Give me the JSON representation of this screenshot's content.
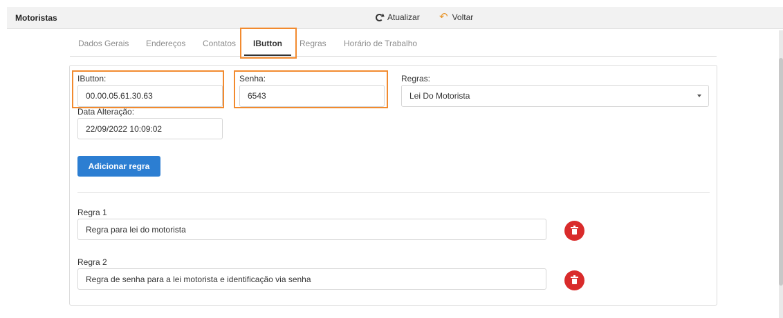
{
  "header": {
    "title": "Motoristas",
    "refresh_label": "Atualizar",
    "back_label": "Voltar"
  },
  "tabs": [
    {
      "label": "Dados Gerais"
    },
    {
      "label": "Endereços"
    },
    {
      "label": "Contatos"
    },
    {
      "label": "IButton"
    },
    {
      "label": "Regras"
    },
    {
      "label": "Horário de Trabalho"
    }
  ],
  "active_tab": "IButton",
  "form": {
    "ibutton_label": "IButton:",
    "ibutton_value": "00.00.05.61.30.63",
    "senha_label": "Senha:",
    "senha_value": "6543",
    "regras_label": "Regras:",
    "regras_selected": "Lei Do Motorista",
    "data_label": "Data Alteração:",
    "data_value": "22/09/2022 10:09:02",
    "add_button": "Adicionar regra"
  },
  "rules": [
    {
      "label": "Regra 1",
      "value": "Regra para lei do motorista"
    },
    {
      "label": "Regra 2",
      "value": "Regra de senha para a lei motorista e identificação via senha"
    }
  ],
  "colors": {
    "highlight": "#f28a2e",
    "primary": "#2c7ed2",
    "danger": "#d92b2b"
  }
}
